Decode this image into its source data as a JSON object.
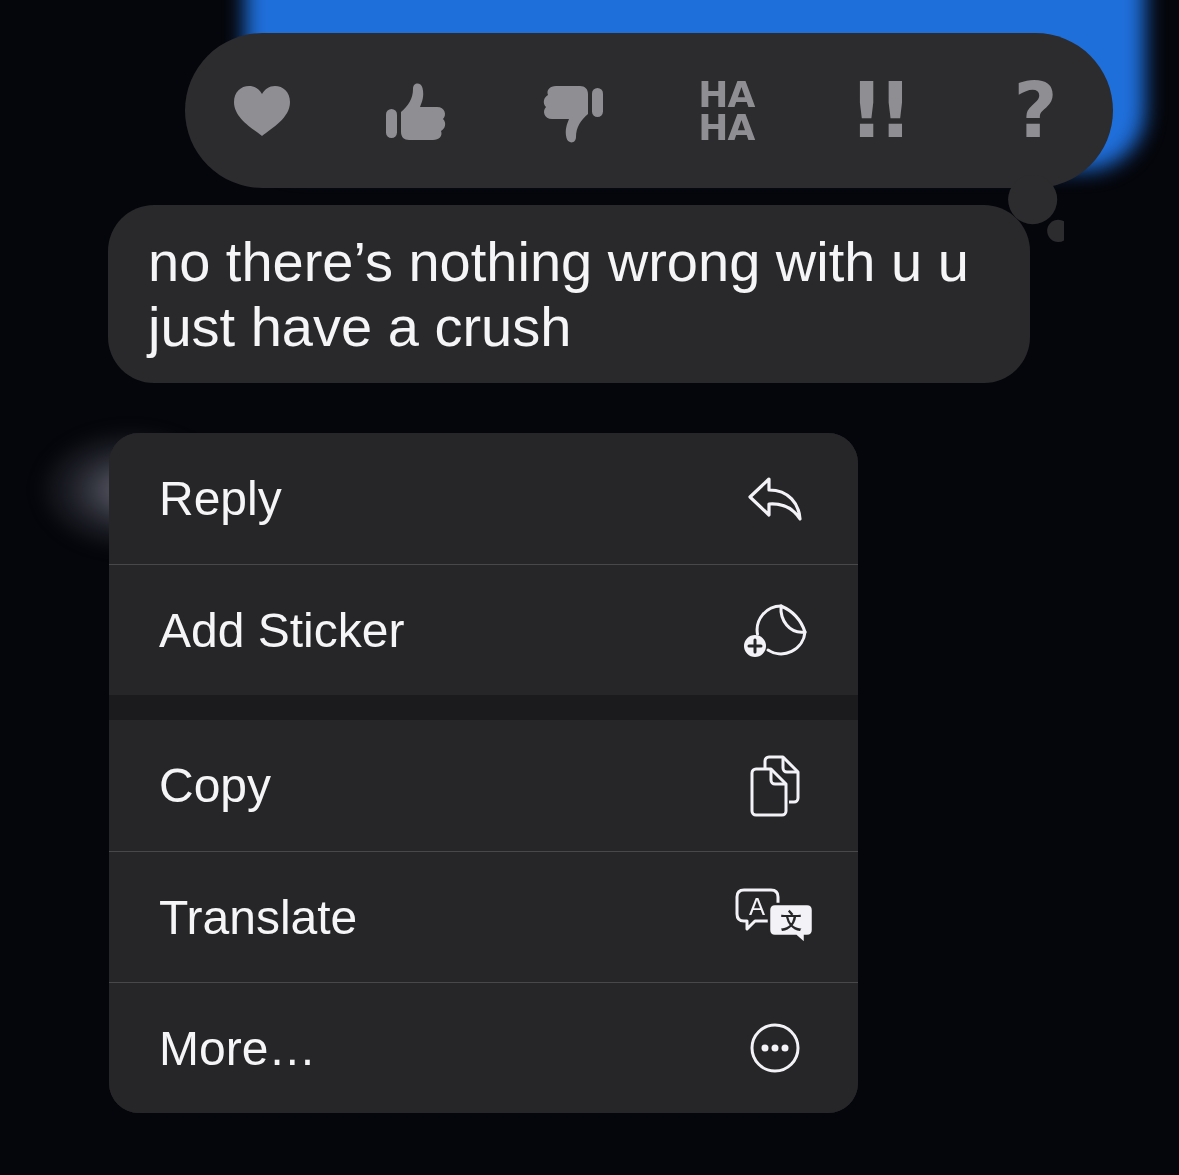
{
  "reaction_bar": {
    "reactions": [
      {
        "kind": "heart"
      },
      {
        "kind": "thumbs-up"
      },
      {
        "kind": "thumbs-down"
      },
      {
        "kind": "haha",
        "lines": [
          "HA",
          "HA"
        ]
      },
      {
        "kind": "emphasis",
        "lines": [
          "!!"
        ]
      },
      {
        "kind": "question",
        "lines": [
          "?"
        ]
      }
    ]
  },
  "message": {
    "text": "no there’s nothing wrong with u u just have a crush"
  },
  "menu": {
    "groups": [
      [
        {
          "label": "Reply",
          "kind": "reply"
        },
        {
          "label": "Add Sticker",
          "kind": "sticker"
        }
      ],
      [
        {
          "label": "Copy",
          "kind": "copy"
        },
        {
          "label": "Translate",
          "kind": "translate",
          "icon_text": [
            "A",
            "文"
          ]
        },
        {
          "label": "More…",
          "kind": "more"
        }
      ]
    ]
  }
}
